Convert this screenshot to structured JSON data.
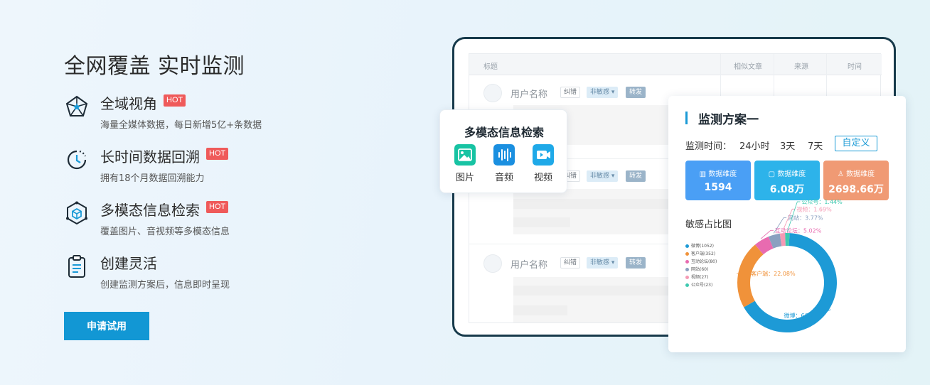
{
  "hero": {
    "headline": "全网覆盖 实时监测",
    "features": [
      {
        "icon": "network-icon",
        "title": "全域视角",
        "hot": "HOT",
        "desc": "海量全媒体数据，每日新增5亿+条数据"
      },
      {
        "icon": "clock-icon",
        "title": "长时间数据回溯",
        "hot": "HOT",
        "desc": "拥有18个月数据回溯能力"
      },
      {
        "icon": "cube-icon",
        "title": "多模态信息检索",
        "hot": "HOT",
        "desc": "覆盖图片、音视频等多模态信息"
      },
      {
        "icon": "clipboard-icon",
        "title": "创建灵活",
        "hot": "",
        "desc": "创建监测方案后，信息即时呈现"
      }
    ],
    "apply_label": "申请试用"
  },
  "table": {
    "headers": [
      "标题",
      "相似文章",
      "来源",
      "时间"
    ],
    "rows": [
      {
        "user": "用户名称",
        "tags": [
          "纠错",
          "非敏感",
          "转发"
        ]
      },
      {
        "user": "",
        "tags": [
          "纠错",
          "非敏感",
          "转发"
        ]
      },
      {
        "user": "用户名称",
        "tags": [
          "纠错",
          "非敏感",
          "转发"
        ]
      }
    ]
  },
  "search_card": {
    "title": "多模态信息检索",
    "items": [
      {
        "label": "图片",
        "icon": "image-icon",
        "color": "#17c3a3"
      },
      {
        "label": "音频",
        "icon": "audio-icon",
        "color": "#1a8fe0"
      },
      {
        "label": "视频",
        "icon": "video-icon",
        "color": "#1fa9e8"
      }
    ]
  },
  "plan_card": {
    "title": "监测方案一",
    "time_label": "监测时间：",
    "time_options": [
      "24小时",
      "3天",
      "7天"
    ],
    "custom_label": "自定义",
    "stats": [
      {
        "label": "数据维度",
        "value": "1594",
        "color": "#4a9ff5",
        "icon": "bar-chart-icon"
      },
      {
        "label": "数据维度",
        "value": "6.08万",
        "color": "#2db3ea",
        "icon": "doc-icon"
      },
      {
        "label": "数据维度",
        "value": "2698.66万",
        "color": "#f09a74",
        "icon": "user-icon"
      }
    ],
    "pie_title": "敏感占比图"
  },
  "chart_data": {
    "type": "pie",
    "title": "敏感占比图",
    "legend": [
      "微博(1052)",
      "客户端(352)",
      "互动论坛(80)",
      "网站(60)",
      "视频(27)",
      "公众号(23)"
    ],
    "series": [
      {
        "name": "微博",
        "label": "微博：66%",
        "value": 66,
        "color": "#1d9ad6"
      },
      {
        "name": "客户端",
        "label": "客户端：22.08%",
        "value": 22.08,
        "color": "#f0923a"
      },
      {
        "name": "互动论坛",
        "label": "互动论坛：5.02%",
        "value": 5.02,
        "color": "#e86bb0"
      },
      {
        "name": "网站",
        "label": "网站：3.77%",
        "value": 3.77,
        "color": "#8aa0c0"
      },
      {
        "name": "视频",
        "label": "视频：1.69%",
        "value": 1.69,
        "color": "#f59ab4"
      },
      {
        "name": "公众号",
        "label": "公众号：1.44%",
        "value": 1.44,
        "color": "#3ec9b0"
      }
    ],
    "legend_position": "left"
  }
}
